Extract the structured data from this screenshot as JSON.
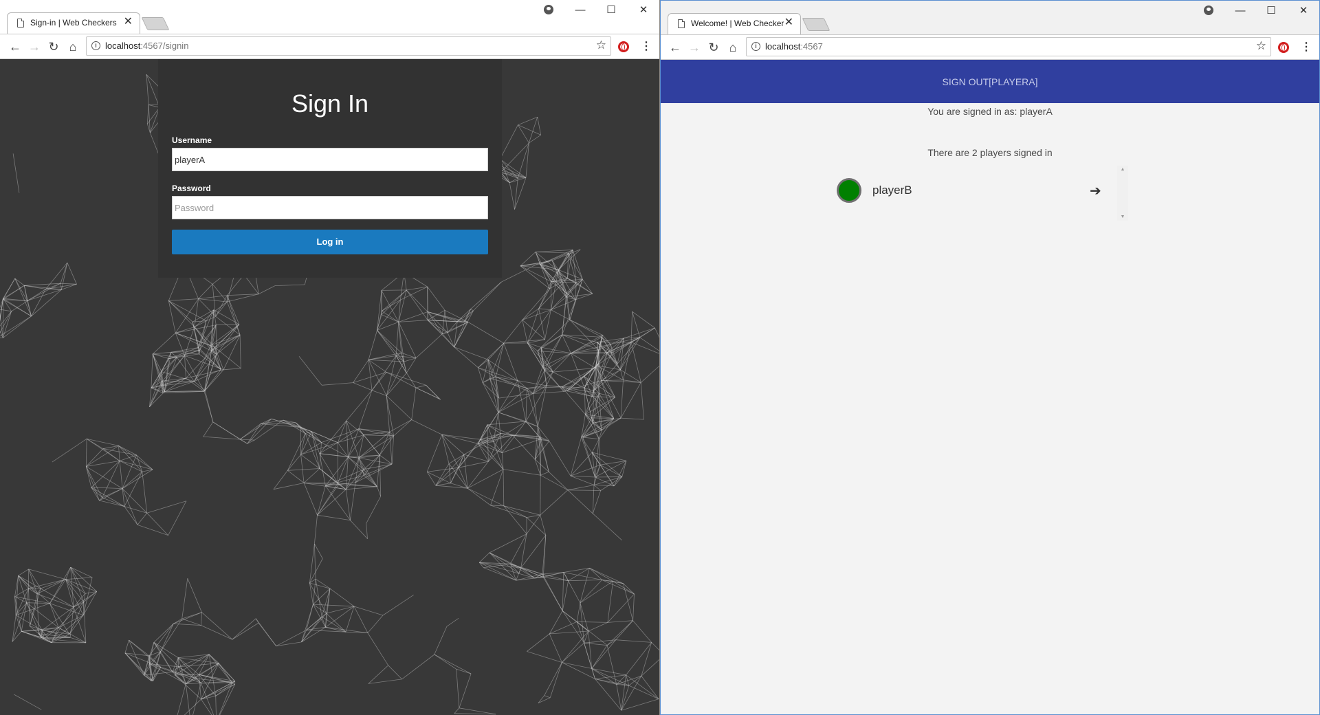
{
  "left_window": {
    "tab": {
      "title": "Sign-in | Web Checkers",
      "close": "✕"
    },
    "url": {
      "host": "localhost",
      "rest": ":4567/signin"
    },
    "window_controls": {
      "minimize": "—",
      "maximize": "☐",
      "close": "✕"
    },
    "icons": {
      "back": "back-arrow-icon",
      "forward": "forward-arrow-icon",
      "reload": "reload-icon",
      "home": "home-icon",
      "info": "info-icon",
      "star": "star-icon",
      "opera": "opera-icon",
      "menu": "menu-icon"
    },
    "signin": {
      "title": "Sign In",
      "username_label": "Username",
      "username_value": "playerA",
      "password_label": "Password",
      "password_placeholder": "Password",
      "login_button": "Log in"
    },
    "colors": {
      "background": "#383838",
      "panel": "#323232",
      "button": "#1a7abf"
    }
  },
  "right_window": {
    "tab": {
      "title": "Welcome! | Web Checkers",
      "close": "✕"
    },
    "url": {
      "host": "localhost",
      "rest": ":4567"
    },
    "window_controls": {
      "minimize": "—",
      "maximize": "☐",
      "close": "✕"
    },
    "navbar": {
      "signout_label": "SIGN OUT[PLAYERA]",
      "color": "#303f9f"
    },
    "signed_in_message": "You are signed in as: playerA",
    "players_count_message": "There are 2 players signed in",
    "players": [
      {
        "name": "playerB",
        "status_color": "#008000",
        "action_icon": "arrow-right-icon"
      }
    ]
  }
}
